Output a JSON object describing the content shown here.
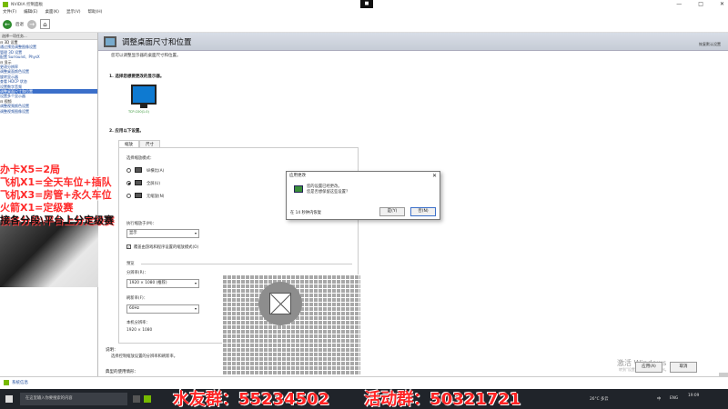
{
  "window": {
    "title": "NVIDIA 控制面板",
    "rec": "■",
    "min": "—",
    "max": "□",
    "close": "✕"
  },
  "menu": [
    "文件(F)",
    "编辑(E)",
    "桌面(K)",
    "显示(V)",
    "帮助(H)"
  ],
  "toolbar": {
    "back_label": "后退",
    "back_glyph": "←",
    "fwd_glyph": "→",
    "home_glyph": "⌂"
  },
  "tree": {
    "header": "选择一项任务...",
    "items": [
      {
        "label": "⊟ 3D 设置",
        "type": "group"
      },
      {
        "label": "    通过预览调整图像设置",
        "type": "link"
      },
      {
        "label": "    管理 3D 设置",
        "type": "link"
      },
      {
        "label": "    配置 Surround、PhysX",
        "type": "link"
      },
      {
        "label": "⊟ 显示",
        "type": "group"
      },
      {
        "label": "    更改分辨率",
        "type": "link"
      },
      {
        "label": "    调整桌面颜色设置",
        "type": "link"
      },
      {
        "label": "    旋转显示器",
        "type": "link"
      },
      {
        "label": "    查看 HDCP 状态",
        "type": "link"
      },
      {
        "label": "    设置数字音频",
        "type": "link"
      },
      {
        "label": "    调整桌面尺寸和位置",
        "type": "selected"
      },
      {
        "label": "    设置多个显示器",
        "type": "link"
      },
      {
        "label": "⊟ 视频",
        "type": "group"
      },
      {
        "label": "    调整视频颜色设置",
        "type": "link"
      },
      {
        "label": "    调整视频图像设置",
        "type": "link"
      }
    ]
  },
  "promo": [
    "办卡X5=2局",
    "飞机X1=全天车位+插队",
    "飞机X3=房管+永久车位",
    "火箭X1=定级赛",
    "接各分段\\平台上分定级赛"
  ],
  "page": {
    "heading": "调整桌面尺寸和位置",
    "restore": "恢复默认设置",
    "intro": "您可以调整显示器的桌面尺寸和位置。",
    "step1": "1.  选择您想要更改的显示器。",
    "display_label": "TCP-C00(1.0)",
    "step2": "2.  应用以下设置。",
    "tabs": [
      "缩放",
      "尺寸"
    ],
    "scaling_mode": "选择缩放模式：",
    "radio_aspect": "纵横比(A)",
    "radio_full": "全屏(U)",
    "radio_none": "无缩放(N)",
    "perform_on": "执行缩放于(M)：",
    "perform_value": "显示",
    "override_label": "覆盖由游戏和程序设置的缩放模式(O)",
    "preview_section": "预览",
    "resolution_label": "分辨率(R)：",
    "resolution_value": "1920 × 1080 (推荐)",
    "refresh_label": "刷新率(F)：",
    "refresh_value": "60Hz",
    "native_label": "本机分辨率：",
    "native_value": "1920 × 1080",
    "desc_label": "说明：",
    "desc_text": "选择控制缩放设置的分辨率和刷新率。",
    "usage_label": "典型的使用情形：",
    "apply": "应用(A)",
    "cancel": "取消",
    "watermark1": "激活 Windows",
    "watermark2": "转到\"设置\"以激活 Windows。"
  },
  "dialog": {
    "title": "应用更改",
    "close": "✕",
    "message_line1": "您的设置已经更改。",
    "message_line2": "您是否想保留这些设置？",
    "countdown_prefix": "在",
    "countdown_value": "14",
    "countdown_suffix": "秒钟内恢复",
    "yes": "是(Y)",
    "no": "否(N)"
  },
  "status": {
    "system_info": "系统信息"
  },
  "taskbar": {
    "search": "在这里输入你要搜索的内容",
    "weather": "26°C 多云",
    "lang": "ENG",
    "time": "19:09",
    "ime": "中"
  },
  "groups": [
    "水友群：55234502",
    "活动群：50321721"
  ]
}
